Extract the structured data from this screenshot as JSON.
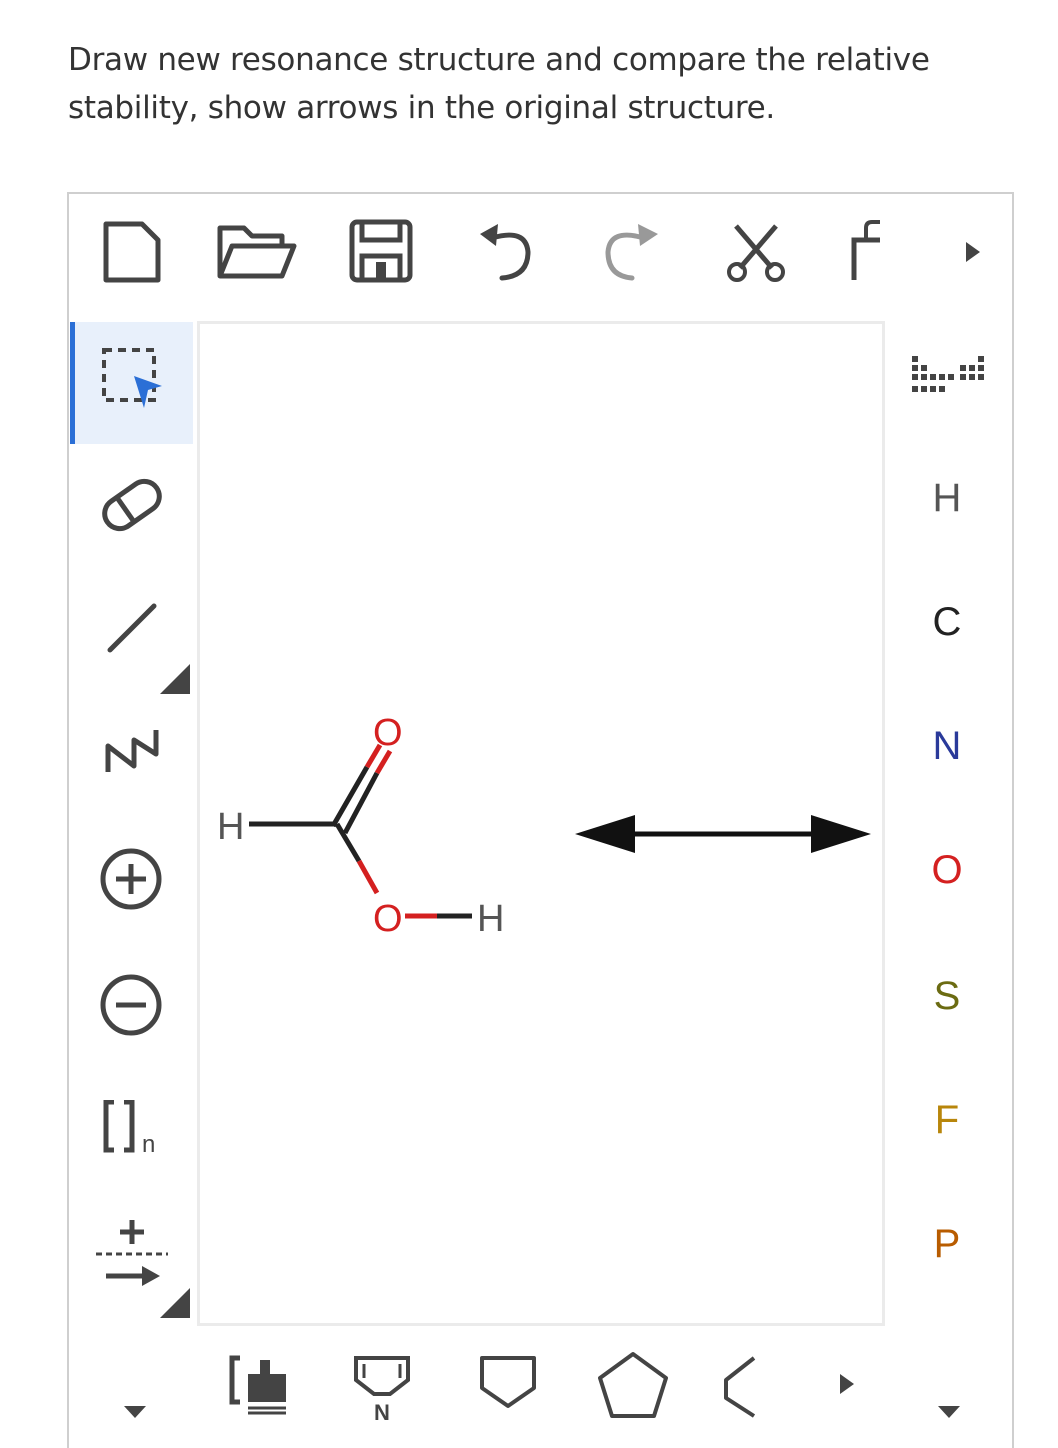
{
  "question": {
    "line1": "Draw new resonance structure and compare the relative",
    "line2": "stability, show arrows in the original structure."
  },
  "toolbar_top": [
    "new-document-icon",
    "open-folder-icon",
    "save-icon",
    "undo-icon",
    "redo-icon",
    "cut-icon",
    "copy-icon",
    "more-arrow-icon"
  ],
  "tools_left": [
    "select-lasso-icon",
    "eraser-icon",
    "single-bond-icon",
    "chain-icon",
    "positive-charge-icon",
    "negative-charge-icon",
    "bracket-icon",
    "reaction-arrow-icon"
  ],
  "elements": [
    {
      "symbol": "H",
      "color": "#555555"
    },
    {
      "symbol": "C",
      "color": "#222222"
    },
    {
      "symbol": "N",
      "color": "#2a3a9a"
    },
    {
      "symbol": "O",
      "color": "#d42020"
    },
    {
      "symbol": "S",
      "color": "#6b6b12"
    },
    {
      "symbol": "F",
      "color": "#b8860b"
    },
    {
      "symbol": "P",
      "color": "#b85c00"
    }
  ],
  "molecule": {
    "atoms": {
      "h_left": "H",
      "o_top": "O",
      "o_bottom": "O",
      "h_right": "H"
    }
  },
  "n_subscript": "n",
  "template_n_label": "N",
  "colors": {
    "accent": "#2b6fd6",
    "oxygen": "#d42020",
    "icon": "#444444"
  }
}
